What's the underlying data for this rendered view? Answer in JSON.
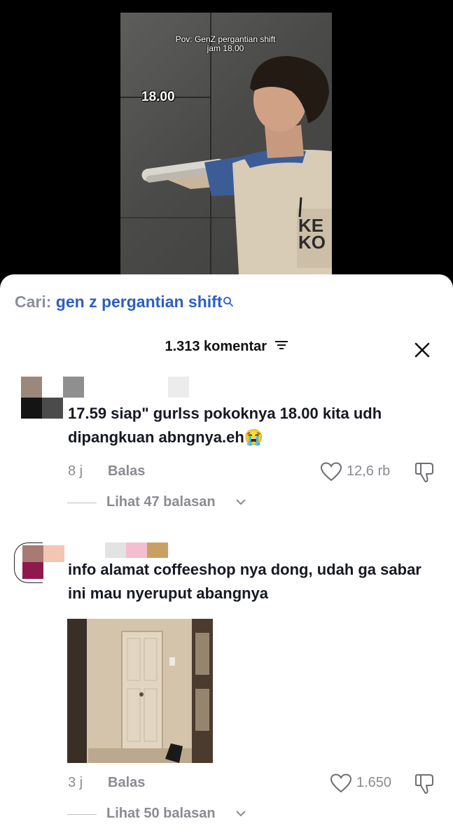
{
  "video": {
    "caption_line1": "Pov: GenZ pergantian shift",
    "caption_line2": "jam 18.00",
    "time_label": "18.00",
    "apron_text_1": "KE",
    "apron_text_2": "KO"
  },
  "search": {
    "prefix": "Cari:",
    "query": "gen z pergantian shift"
  },
  "header": {
    "count_label": "1.313 komentar"
  },
  "comments": [
    {
      "text": "17.59 siap\" gurlss pokoknya 18.00 kita udh dipangkuan abngnya.eh😭",
      "time": "8 j",
      "reply_label": "Balas",
      "likes": "12,6 rb",
      "view_replies": "Lihat 47 balasan"
    },
    {
      "text": "info alamat coffeeshop nya dong, udah ga sabar ini mau nyeruput abangnya",
      "time": "3 j",
      "reply_label": "Balas",
      "likes": "1.650",
      "view_replies": "Lihat 50 balasan"
    }
  ],
  "colors": {
    "search_prefix": "#8a8f99",
    "search_query": "#2d5fc2",
    "meta_gray": "#8a8b91",
    "text_dark": "#161823"
  }
}
